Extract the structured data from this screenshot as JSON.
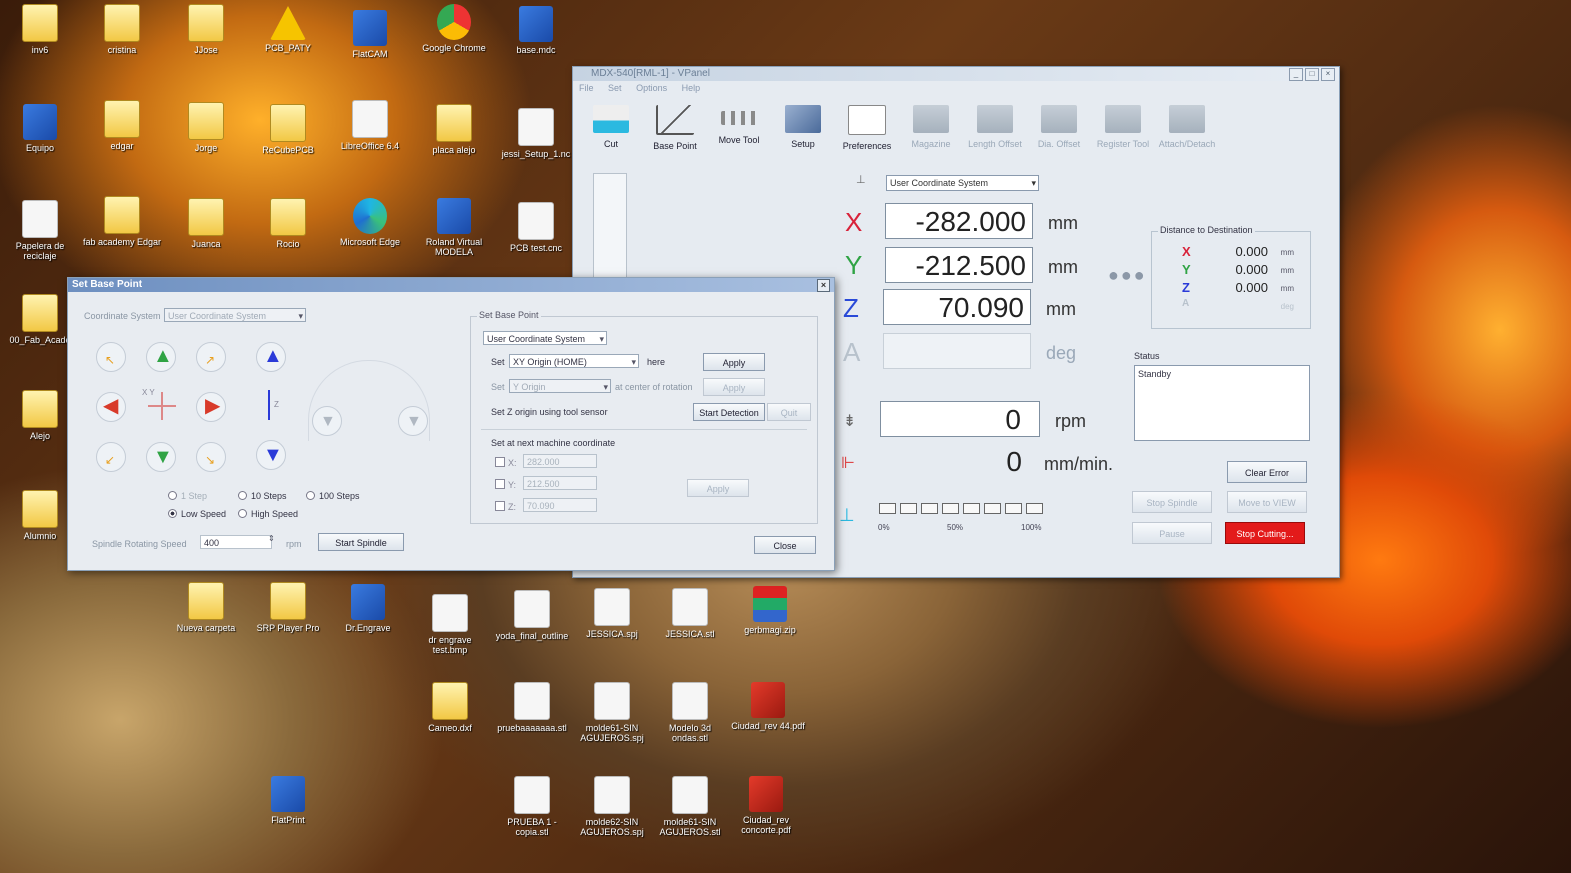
{
  "desktop_icons": [
    {
      "label": "inv6",
      "kind": "folder"
    },
    {
      "label": "cristina",
      "kind": "folder"
    },
    {
      "label": "JJose",
      "kind": "folder"
    },
    {
      "label": "PCB_PATY",
      "kind": "warn"
    },
    {
      "label": "FlatCAM",
      "kind": "app"
    },
    {
      "label": "Google Chrome",
      "kind": "chrome"
    },
    {
      "label": "base.mdc",
      "kind": "app"
    },
    {
      "label": "Equipo",
      "kind": "app"
    },
    {
      "label": "edgar",
      "kind": "folder"
    },
    {
      "label": "Jorge",
      "kind": "folder"
    },
    {
      "label": "ReCubePCB",
      "kind": "folder"
    },
    {
      "label": "LibreOffice 6.4",
      "kind": "file"
    },
    {
      "label": "placa alejo",
      "kind": "folder"
    },
    {
      "label": "jessi_Setup_1.nc",
      "kind": "file"
    },
    {
      "label": "Papelera de reciclaje",
      "kind": "file"
    },
    {
      "label": "fab academy Edgar",
      "kind": "folder"
    },
    {
      "label": "Juanca",
      "kind": "folder"
    },
    {
      "label": "Rocio",
      "kind": "folder"
    },
    {
      "label": "Microsoft Edge",
      "kind": "edge"
    },
    {
      "label": "Roland Virtual MODELA",
      "kind": "app"
    },
    {
      "label": "PCB test.cnc",
      "kind": "file"
    },
    {
      "label": "00_Fab_Acade",
      "kind": "folder"
    },
    {
      "label": "Alejo",
      "kind": "folder"
    },
    {
      "label": "Alumnio",
      "kind": "folder"
    },
    {
      "label": "Dr.Engrave",
      "kind": "app"
    },
    {
      "label": "dr engrave test.bmp",
      "kind": "file"
    },
    {
      "label": "yoda_final_outline",
      "kind": "file"
    },
    {
      "label": "JESSICA.spj",
      "kind": "file"
    },
    {
      "label": "JESSICA.stl",
      "kind": "file"
    },
    {
      "label": "gerbmagi.zip",
      "kind": "zip"
    },
    {
      "label": "Nueva carpeta",
      "kind": "folder"
    },
    {
      "label": "SRP Player Pro",
      "kind": "folder"
    },
    {
      "label": "Cameo.dxf",
      "kind": "folder"
    },
    {
      "label": "pruebaaaaaaa.stl",
      "kind": "file"
    },
    {
      "label": "molde61-SIN AGUJEROS.spj",
      "kind": "file"
    },
    {
      "label": "Modelo 3d ondas.stl",
      "kind": "file"
    },
    {
      "label": "Ciudad_rev 44.pdf",
      "kind": "red"
    },
    {
      "label": "FlatPrint",
      "kind": "app"
    },
    {
      "label": "PRUEBA 1 - copia.stl",
      "kind": "file"
    },
    {
      "label": "molde62-SIN AGUJEROS.spj",
      "kind": "file"
    },
    {
      "label": "molde61-SIN AGUJEROS.stl",
      "kind": "file"
    },
    {
      "label": "Ciudad_rev concorte.pdf",
      "kind": "red"
    }
  ],
  "vpanel": {
    "title": "MDX-540[RML-1] - VPanel",
    "menu": [
      "File",
      "Set",
      "Options",
      "Help"
    ],
    "toolbar": [
      {
        "label": "Cut",
        "icon": "cut-icon",
        "enabled": true
      },
      {
        "label": "Base Point",
        "icon": "base-point-icon",
        "enabled": true
      },
      {
        "label": "Move Tool",
        "icon": "move-tool-icon",
        "enabled": true
      },
      {
        "label": "Setup",
        "icon": "setup-icon",
        "enabled": true
      },
      {
        "label": "Preferences",
        "icon": "preferences-icon",
        "enabled": true
      },
      {
        "label": "Magazine",
        "icon": "magazine-icon",
        "enabled": false
      },
      {
        "label": "Length Offset",
        "icon": "length-offset-icon",
        "enabled": false
      },
      {
        "label": "Dia. Offset",
        "icon": "dia-offset-icon",
        "enabled": false
      },
      {
        "label": "Register Tool",
        "icon": "register-tool-icon",
        "enabled": false
      },
      {
        "label": "Attach/Detach",
        "icon": "attach-detach-icon",
        "enabled": false
      }
    ],
    "coord_system": "User Coordinate System",
    "axes": [
      {
        "name": "X",
        "value": "-282.000",
        "unit": "mm",
        "color": "#d8223a"
      },
      {
        "name": "Y",
        "value": "-212.500",
        "unit": "mm",
        "color": "#2fa344"
      },
      {
        "name": "Z",
        "value": "70.090",
        "unit": "mm",
        "color": "#2a4ad8"
      },
      {
        "name": "A",
        "value": "",
        "unit": "deg",
        "color": "#b8c2cc"
      }
    ],
    "distance": {
      "title": "Distance to Destination",
      "rows": [
        {
          "name": "X",
          "value": "0.000",
          "unit": "mm",
          "color": "#d8223a"
        },
        {
          "name": "Y",
          "value": "0.000",
          "unit": "mm",
          "color": "#2fa344"
        },
        {
          "name": "Z",
          "value": "0.000",
          "unit": "mm",
          "color": "#2a3ad8"
        },
        {
          "name": "A",
          "value": "",
          "unit": "deg",
          "color": "#b8c2cc"
        }
      ]
    },
    "status_label": "Status",
    "status_text": "Standby",
    "spindle": {
      "value": "0",
      "unit": "rpm"
    },
    "feed": {
      "value": "0",
      "unit": "mm/min."
    },
    "progress_labels": [
      "0%",
      "50%",
      "100%"
    ],
    "buttons": {
      "clear_error": "Clear Error",
      "stop_spindle": "Stop Spindle",
      "move_to_view": "Move to VIEW",
      "pause": "Pause",
      "stop_cutting": "Stop Cutting..."
    }
  },
  "dialog": {
    "title": "Set Base Point",
    "coord_label": "Coordinate System",
    "coord_value": "User Coordinate System",
    "xy_label": "X Y",
    "z_label": "Z",
    "speed_options": [
      "1 Step",
      "10 Steps",
      "100 Steps"
    ],
    "motion_options": [
      "Low Speed",
      "High Speed"
    ],
    "spindle_label": "Spindle Rotating Speed",
    "spindle_value": "400",
    "spindle_unit": "rpm",
    "start_spindle": "Start Spindle",
    "set_base_point": {
      "group_title": "Set Base Point",
      "coord_value": "User Coordinate System",
      "set_label": "Set",
      "set_value": "XY Origin (HOME)",
      "here_label": "here",
      "apply": "Apply",
      "set2_label": "Set",
      "set2_value": "Y Origin",
      "set2_suffix": "at center of rotation",
      "apply2": "Apply",
      "z_sensor_label": "Set Z origin using tool sensor",
      "start_detection": "Start Detection",
      "quit": "Quit",
      "next_machine_label": "Set at next machine coordinate",
      "x_label": "X:",
      "x_value": "282.000",
      "y_label": "Y:",
      "y_value": "212.500",
      "z_label": "Z:",
      "z_value": "70.090",
      "apply3": "Apply"
    },
    "close": "Close"
  }
}
